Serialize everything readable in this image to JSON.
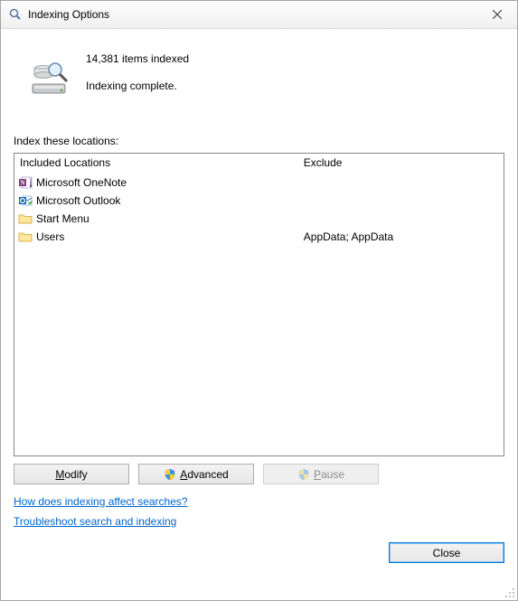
{
  "window": {
    "title": "Indexing Options"
  },
  "status": {
    "count_text": "14,381 items indexed",
    "state_text": "Indexing complete."
  },
  "section_label": "Index these locations:",
  "columns": {
    "included": "Included Locations",
    "exclude": "Exclude"
  },
  "locations": [
    {
      "name": "Microsoft OneNote",
      "exclude": "",
      "icon": "onenote"
    },
    {
      "name": "Microsoft Outlook",
      "exclude": "",
      "icon": "outlook"
    },
    {
      "name": "Start Menu",
      "exclude": "",
      "icon": "folder"
    },
    {
      "name": "Users",
      "exclude": "AppData; AppData",
      "icon": "folder"
    }
  ],
  "buttons": {
    "modify": "Modify",
    "advanced": "Advanced",
    "pause": "Pause",
    "close": "Close"
  },
  "links": {
    "how": "How does indexing affect searches?",
    "troubleshoot": "Troubleshoot search and indexing"
  }
}
